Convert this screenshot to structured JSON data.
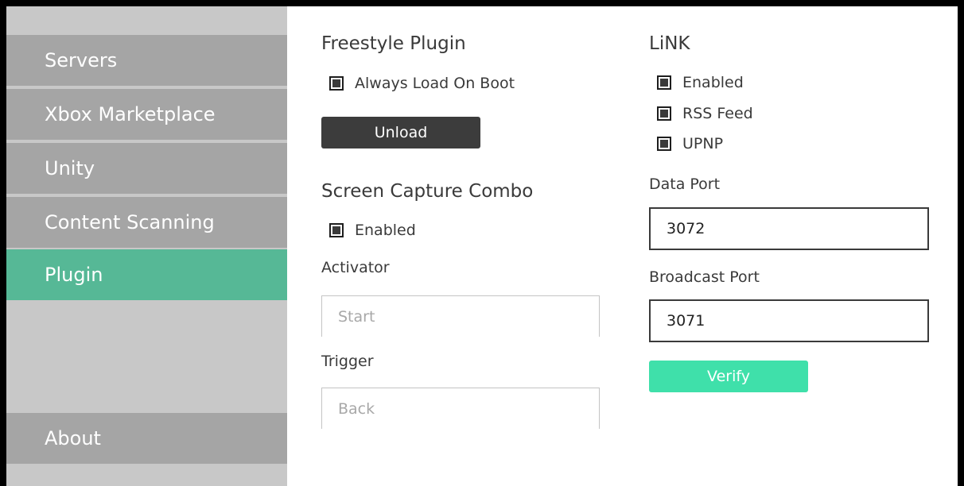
{
  "sidebar": {
    "items": [
      {
        "label": "Servers"
      },
      {
        "label": "Xbox Marketplace"
      },
      {
        "label": "Unity"
      },
      {
        "label": "Content Scanning"
      },
      {
        "label": "Plugin",
        "active": true
      },
      {
        "label": "About"
      }
    ]
  },
  "freestyle_plugin": {
    "title": "Freestyle Plugin",
    "always_load_label": "Always Load On Boot",
    "always_load_checked": true,
    "unload_label": "Unload"
  },
  "screen_capture": {
    "title": "Screen Capture Combo",
    "enabled_label": "Enabled",
    "enabled_checked": true,
    "activator_label": "Activator",
    "activator_placeholder": "Start",
    "trigger_label": "Trigger",
    "trigger_placeholder": "Back"
  },
  "link": {
    "title": "LiNK",
    "options": [
      {
        "label": "Enabled",
        "checked": true
      },
      {
        "label": "RSS Feed",
        "checked": true
      },
      {
        "label": "UPNP",
        "checked": true
      }
    ],
    "data_port_label": "Data Port",
    "data_port_value": "3072",
    "broadcast_port_label": "Broadcast Port",
    "broadcast_port_value": "3071",
    "verify_label": "Verify"
  },
  "colors": {
    "active_nav": "#56b896",
    "nav_item": "#a5a5a5",
    "sidebar_bg": "#c8c8c8",
    "verify_button": "#3fe0aa",
    "unload_button": "#3c3c3c"
  }
}
